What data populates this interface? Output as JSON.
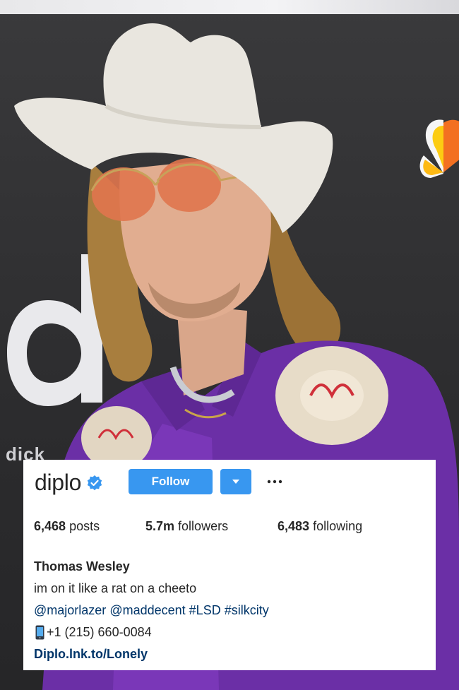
{
  "backdrop": {
    "word": "dick"
  },
  "profile": {
    "username": "diplo",
    "verified": true,
    "follow_label": "Follow",
    "more_label": "···",
    "stats": {
      "posts_count": "6,468",
      "posts_label": "posts",
      "followers_count": "5.7m",
      "followers_label": "followers",
      "following_count": "6,483",
      "following_label": "following"
    },
    "full_name": "Thomas Wesley",
    "bio_text": "im on it like a rat on a cheeto",
    "tags": [
      "@majorlazer",
      "@maddecent",
      "#LSD",
      "#silkcity"
    ],
    "phone": "+1 (215) 660-0084",
    "link": "Diplo.lnk.to/Lonely"
  },
  "colors": {
    "accent": "#3897f0",
    "link": "#003569",
    "text": "#262626"
  },
  "icons": {
    "verified": "verified-badge-icon",
    "dropdown": "caret-down-icon",
    "phone": "mobile-phone-icon"
  }
}
